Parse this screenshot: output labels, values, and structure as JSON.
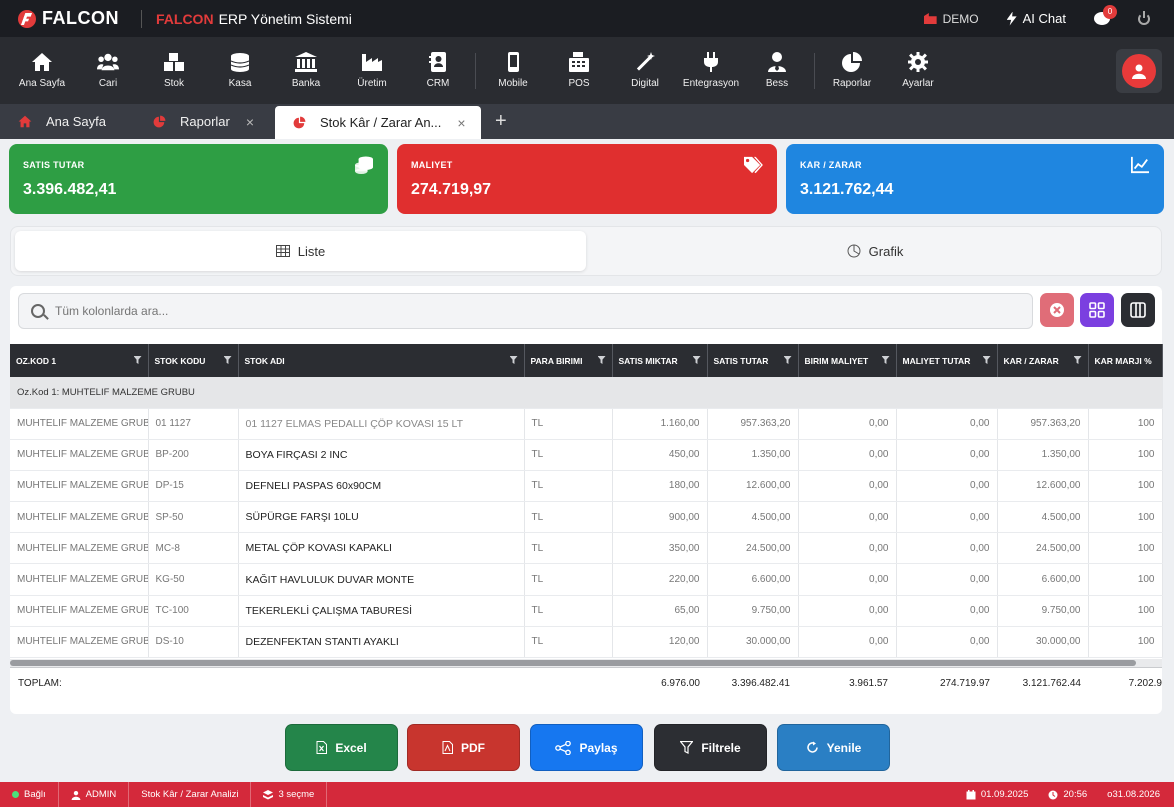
{
  "app": {
    "logo": "FALCON",
    "brand": "FALCON",
    "subtitle": "ERP Yönetim Sistemi",
    "demo_label": "DEMO",
    "ai_chat_label": "AI Chat",
    "notification_count": "0"
  },
  "modules": [
    {
      "label": "Ana Sayfa",
      "icon": "home-icon"
    },
    {
      "label": "Cari",
      "icon": "users-icon"
    },
    {
      "label": "Stok",
      "icon": "boxes-icon"
    },
    {
      "label": "Kasa",
      "icon": "coins-icon"
    },
    {
      "label": "Banka",
      "icon": "bank-icon"
    },
    {
      "label": "Üretim",
      "icon": "factory-icon"
    },
    {
      "label": "CRM",
      "icon": "contacts-icon"
    },
    {
      "label": "Mobile",
      "icon": "mobile-icon"
    },
    {
      "label": "POS",
      "icon": "cash-register-icon"
    },
    {
      "label": "Digital",
      "icon": "magic-wand-icon"
    },
    {
      "label": "Entegrasyon",
      "icon": "plug-icon"
    },
    {
      "label": "Bess",
      "icon": "user-tie-icon"
    },
    {
      "label": "Raporlar",
      "icon": "pie-chart-icon"
    },
    {
      "label": "Ayarlar",
      "icon": "gear-icon"
    }
  ],
  "tabs": [
    {
      "label": "Ana Sayfa",
      "icon": "home-icon"
    },
    {
      "label": "Raporlar",
      "icon": "pie-chart-icon"
    },
    {
      "label": "Stok Kâr / Zarar An...",
      "icon": "pie-chart-icon"
    }
  ],
  "cards": {
    "sales": {
      "label": "SATIS TUTAR",
      "value": "3.396.482,41",
      "color": "#2e9e44"
    },
    "cost": {
      "label": "MALIYET",
      "value": "274.719,97",
      "color": "#e02f2f"
    },
    "profit": {
      "label": "KAR / ZARAR",
      "value": "3.121.762,44",
      "color": "#1f86e0"
    }
  },
  "view": {
    "list_label": "Liste",
    "chart_label": "Grafik"
  },
  "search": {
    "placeholder": "Tüm kolonlarda ara..."
  },
  "table": {
    "columns": [
      "OZ.KOD 1",
      "STOK KODU",
      "STOK ADI",
      "PARA BIRIMI",
      "SATIS MIKTAR",
      "SATIS TUTAR",
      "BIRIM MALIYET",
      "MALIYET TUTAR",
      "KAR / ZARAR",
      "KAR MARJI %"
    ],
    "group_label": "Oz.Kod 1: MUHTELIF MALZEME GRUBU",
    "rows": [
      [
        "MUHTELIF MALZEME GRUBU",
        "01 1127",
        "01 1127 ELMAS PEDALLI ÇÖP KOVASI 15 LT",
        "TL",
        "1.160,00",
        "957.363,20",
        "0,00",
        "0,00",
        "957.363,20",
        "100"
      ],
      [
        "MUHTELIF MALZEME GRUBU",
        "BP-200",
        "BOYA FIRÇASI 2 INC",
        "TL",
        "450,00",
        "1.350,00",
        "0,00",
        "0,00",
        "1.350,00",
        "100"
      ],
      [
        "MUHTELIF MALZEME GRUBU",
        "DP-15",
        "DEFNELI PASPAS 60x90CM",
        "TL",
        "180,00",
        "12.600,00",
        "0,00",
        "0,00",
        "12.600,00",
        "100"
      ],
      [
        "MUHTELIF MALZEME GRUBU",
        "SP-50",
        "SÜPÜRGE FARŞI 10LU",
        "TL",
        "900,00",
        "4.500,00",
        "0,00",
        "0,00",
        "4.500,00",
        "100"
      ],
      [
        "MUHTELIF MALZEME GRUBU",
        "MC-8",
        "METAL ÇÖP KOVASI KAPAKLI",
        "TL",
        "350,00",
        "24.500,00",
        "0,00",
        "0,00",
        "24.500,00",
        "100"
      ],
      [
        "MUHTELIF MALZEME GRUBU",
        "KG-50",
        "KAĞIT HAVLULUK DUVAR MONTE",
        "TL",
        "220,00",
        "6.600,00",
        "0,00",
        "0,00",
        "6.600,00",
        "100"
      ],
      [
        "MUHTELIF MALZEME GRUBU",
        "TC-100",
        "TEKERLEKLİ ÇALIŞMA TABURESİ",
        "TL",
        "65,00",
        "9.750,00",
        "0,00",
        "0,00",
        "9.750,00",
        "100"
      ],
      [
        "MUHTELIF MALZEME GRUBU",
        "DS-10",
        "DEZENFEKTAN STANTI AYAKLI",
        "TL",
        "120,00",
        "30.000,00",
        "0,00",
        "0,00",
        "30.000,00",
        "100"
      ]
    ],
    "totals": {
      "label": "TOPLAM:",
      "satis_miktar": "6.976.00",
      "satis_tutar": "3.396.482.41",
      "birim_maliyet": "3.961.57",
      "maliyet_tutar": "274.719.97",
      "kar_zarar": "3.121.762.44",
      "kar_marji": "7.202.9"
    }
  },
  "actions": {
    "excel": "Excel",
    "pdf": "PDF",
    "share": "Paylaş",
    "filter": "Filtrele",
    "refresh": "Yenile"
  },
  "status": {
    "connection": "Bağlı",
    "user": "ADMIN",
    "screen": "Stok Kâr / Zarar Analizi",
    "selection": "3 seçme",
    "date": "01.09.2025",
    "time": "20:56",
    "version": "o31.08.2026"
  }
}
